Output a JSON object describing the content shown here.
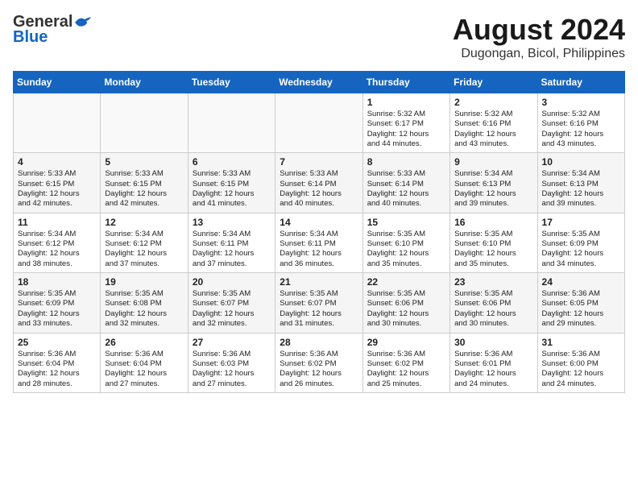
{
  "header": {
    "logo_general": "General",
    "logo_blue": "Blue",
    "title": "August 2024",
    "subtitle": "Dugongan, Bicol, Philippines"
  },
  "weekdays": [
    "Sunday",
    "Monday",
    "Tuesday",
    "Wednesday",
    "Thursday",
    "Friday",
    "Saturday"
  ],
  "weeks": [
    [
      {
        "day": "",
        "info": ""
      },
      {
        "day": "",
        "info": ""
      },
      {
        "day": "",
        "info": ""
      },
      {
        "day": "",
        "info": ""
      },
      {
        "day": "1",
        "info": "Sunrise: 5:32 AM\nSunset: 6:17 PM\nDaylight: 12 hours\nand 44 minutes."
      },
      {
        "day": "2",
        "info": "Sunrise: 5:32 AM\nSunset: 6:16 PM\nDaylight: 12 hours\nand 43 minutes."
      },
      {
        "day": "3",
        "info": "Sunrise: 5:32 AM\nSunset: 6:16 PM\nDaylight: 12 hours\nand 43 minutes."
      }
    ],
    [
      {
        "day": "4",
        "info": "Sunrise: 5:33 AM\nSunset: 6:15 PM\nDaylight: 12 hours\nand 42 minutes."
      },
      {
        "day": "5",
        "info": "Sunrise: 5:33 AM\nSunset: 6:15 PM\nDaylight: 12 hours\nand 42 minutes."
      },
      {
        "day": "6",
        "info": "Sunrise: 5:33 AM\nSunset: 6:15 PM\nDaylight: 12 hours\nand 41 minutes."
      },
      {
        "day": "7",
        "info": "Sunrise: 5:33 AM\nSunset: 6:14 PM\nDaylight: 12 hours\nand 40 minutes."
      },
      {
        "day": "8",
        "info": "Sunrise: 5:33 AM\nSunset: 6:14 PM\nDaylight: 12 hours\nand 40 minutes."
      },
      {
        "day": "9",
        "info": "Sunrise: 5:34 AM\nSunset: 6:13 PM\nDaylight: 12 hours\nand 39 minutes."
      },
      {
        "day": "10",
        "info": "Sunrise: 5:34 AM\nSunset: 6:13 PM\nDaylight: 12 hours\nand 39 minutes."
      }
    ],
    [
      {
        "day": "11",
        "info": "Sunrise: 5:34 AM\nSunset: 6:12 PM\nDaylight: 12 hours\nand 38 minutes."
      },
      {
        "day": "12",
        "info": "Sunrise: 5:34 AM\nSunset: 6:12 PM\nDaylight: 12 hours\nand 37 minutes."
      },
      {
        "day": "13",
        "info": "Sunrise: 5:34 AM\nSunset: 6:11 PM\nDaylight: 12 hours\nand 37 minutes."
      },
      {
        "day": "14",
        "info": "Sunrise: 5:34 AM\nSunset: 6:11 PM\nDaylight: 12 hours\nand 36 minutes."
      },
      {
        "day": "15",
        "info": "Sunrise: 5:35 AM\nSunset: 6:10 PM\nDaylight: 12 hours\nand 35 minutes."
      },
      {
        "day": "16",
        "info": "Sunrise: 5:35 AM\nSunset: 6:10 PM\nDaylight: 12 hours\nand 35 minutes."
      },
      {
        "day": "17",
        "info": "Sunrise: 5:35 AM\nSunset: 6:09 PM\nDaylight: 12 hours\nand 34 minutes."
      }
    ],
    [
      {
        "day": "18",
        "info": "Sunrise: 5:35 AM\nSunset: 6:09 PM\nDaylight: 12 hours\nand 33 minutes."
      },
      {
        "day": "19",
        "info": "Sunrise: 5:35 AM\nSunset: 6:08 PM\nDaylight: 12 hours\nand 32 minutes."
      },
      {
        "day": "20",
        "info": "Sunrise: 5:35 AM\nSunset: 6:07 PM\nDaylight: 12 hours\nand 32 minutes."
      },
      {
        "day": "21",
        "info": "Sunrise: 5:35 AM\nSunset: 6:07 PM\nDaylight: 12 hours\nand 31 minutes."
      },
      {
        "day": "22",
        "info": "Sunrise: 5:35 AM\nSunset: 6:06 PM\nDaylight: 12 hours\nand 30 minutes."
      },
      {
        "day": "23",
        "info": "Sunrise: 5:35 AM\nSunset: 6:06 PM\nDaylight: 12 hours\nand 30 minutes."
      },
      {
        "day": "24",
        "info": "Sunrise: 5:36 AM\nSunset: 6:05 PM\nDaylight: 12 hours\nand 29 minutes."
      }
    ],
    [
      {
        "day": "25",
        "info": "Sunrise: 5:36 AM\nSunset: 6:04 PM\nDaylight: 12 hours\nand 28 minutes."
      },
      {
        "day": "26",
        "info": "Sunrise: 5:36 AM\nSunset: 6:04 PM\nDaylight: 12 hours\nand 27 minutes."
      },
      {
        "day": "27",
        "info": "Sunrise: 5:36 AM\nSunset: 6:03 PM\nDaylight: 12 hours\nand 27 minutes."
      },
      {
        "day": "28",
        "info": "Sunrise: 5:36 AM\nSunset: 6:02 PM\nDaylight: 12 hours\nand 26 minutes."
      },
      {
        "day": "29",
        "info": "Sunrise: 5:36 AM\nSunset: 6:02 PM\nDaylight: 12 hours\nand 25 minutes."
      },
      {
        "day": "30",
        "info": "Sunrise: 5:36 AM\nSunset: 6:01 PM\nDaylight: 12 hours\nand 24 minutes."
      },
      {
        "day": "31",
        "info": "Sunrise: 5:36 AM\nSunset: 6:00 PM\nDaylight: 12 hours\nand 24 minutes."
      }
    ]
  ]
}
